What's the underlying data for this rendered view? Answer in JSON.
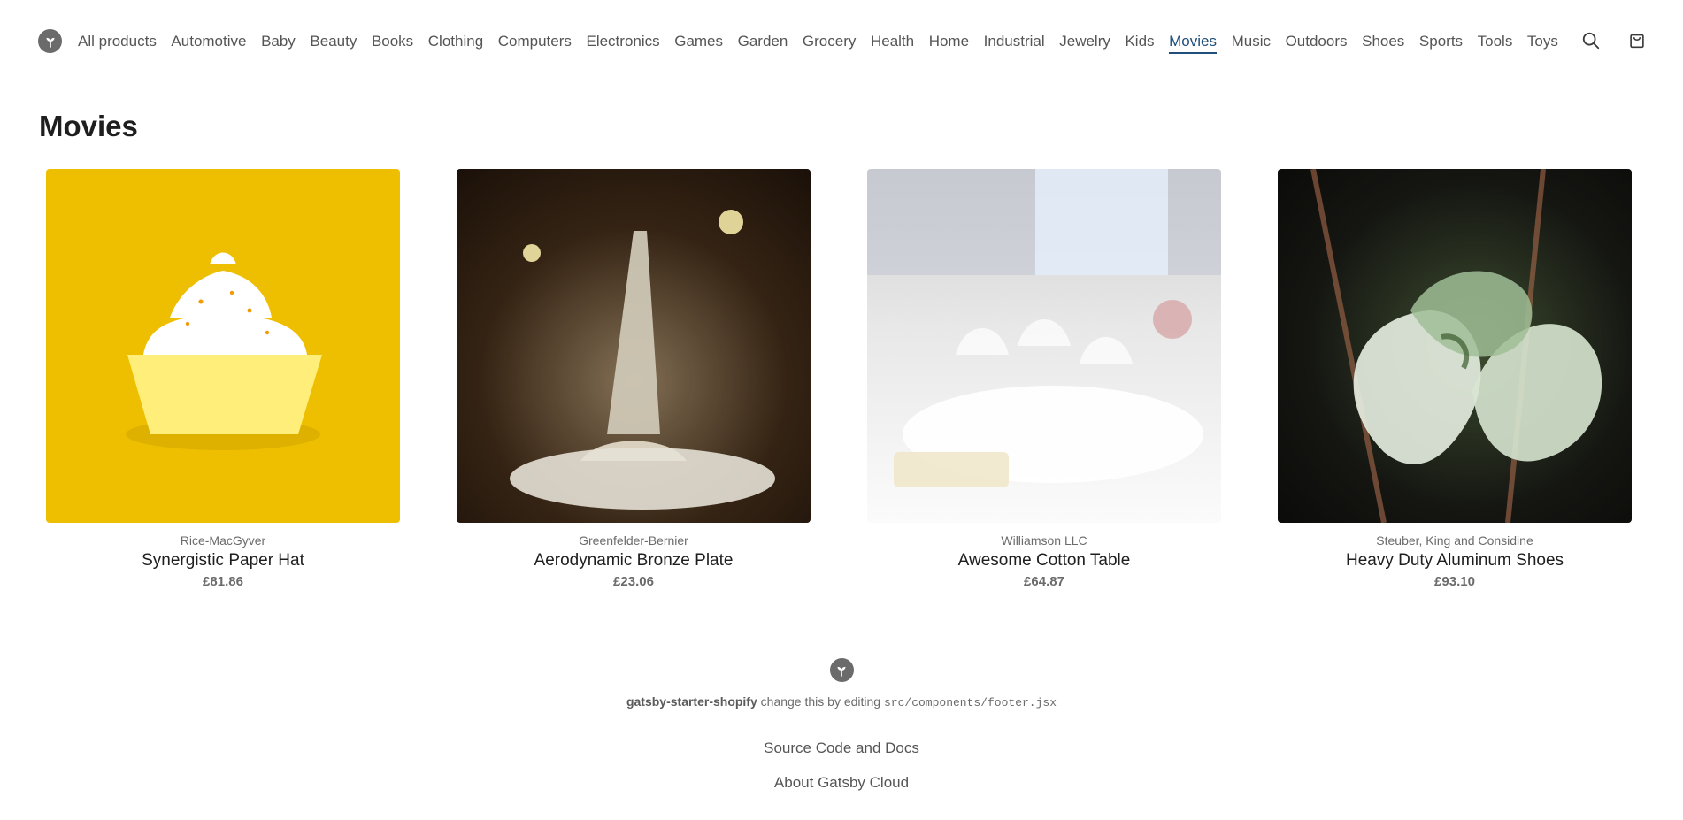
{
  "nav": {
    "items": [
      {
        "label": "All products",
        "active": false
      },
      {
        "label": "Automotive",
        "active": false
      },
      {
        "label": "Baby",
        "active": false
      },
      {
        "label": "Beauty",
        "active": false
      },
      {
        "label": "Books",
        "active": false
      },
      {
        "label": "Clothing",
        "active": false
      },
      {
        "label": "Computers",
        "active": false
      },
      {
        "label": "Electronics",
        "active": false
      },
      {
        "label": "Games",
        "active": false
      },
      {
        "label": "Garden",
        "active": false
      },
      {
        "label": "Grocery",
        "active": false
      },
      {
        "label": "Health",
        "active": false
      },
      {
        "label": "Home",
        "active": false
      },
      {
        "label": "Industrial",
        "active": false
      },
      {
        "label": "Jewelry",
        "active": false
      },
      {
        "label": "Kids",
        "active": false
      },
      {
        "label": "Movies",
        "active": true
      },
      {
        "label": "Music",
        "active": false
      },
      {
        "label": "Outdoors",
        "active": false
      },
      {
        "label": "Shoes",
        "active": false
      },
      {
        "label": "Sports",
        "active": false
      },
      {
        "label": "Tools",
        "active": false
      },
      {
        "label": "Toys",
        "active": false
      }
    ]
  },
  "icons": {
    "logo": "leaf-logo-icon",
    "search": "search-icon",
    "cart": "shopping-bag-icon"
  },
  "page": {
    "title": "Movies"
  },
  "products": [
    {
      "vendor": "Rice-MacGyver",
      "title": "Synergistic Paper Hat",
      "price": "£81.86"
    },
    {
      "vendor": "Greenfelder-Bernier",
      "title": "Aerodynamic Bronze Plate",
      "price": "£23.06"
    },
    {
      "vendor": "Williamson LLC",
      "title": "Awesome Cotton Table",
      "price": "£64.87"
    },
    {
      "vendor": "Steuber, King and Considine",
      "title": "Heavy Duty Aluminum Shoes",
      "price": "£93.10"
    }
  ],
  "footer": {
    "brand": "gatsby-starter-shopify",
    "note_mid": " change this by editing ",
    "note_code": "src/components/footer.jsx",
    "links": [
      "Source Code and Docs",
      "About Gatsby Cloud"
    ]
  },
  "colors": {
    "accent": "#1f4f7a",
    "text": "#1e1e1e",
    "muted": "#6b6b6b",
    "logo": "#6b6b6b"
  }
}
